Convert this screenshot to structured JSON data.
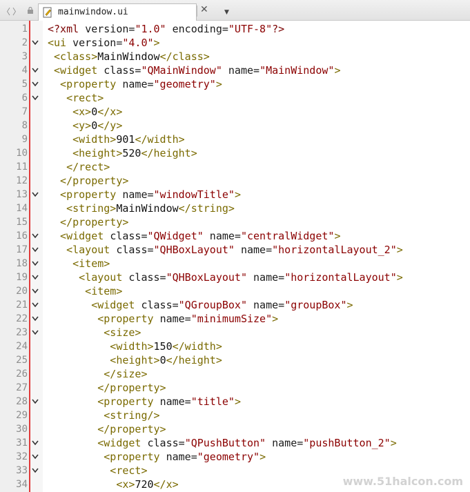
{
  "tab": {
    "title": "mainwindow.ui",
    "icons": [
      "back-arrow-icon",
      "forward-arrow-icon",
      "lock-icon",
      "file-icon",
      "dropdown-icon",
      "close-icon"
    ]
  },
  "colors": {
    "accent_line": "#e03a3a",
    "tag": "#7a6a00",
    "value": "#8b0000"
  },
  "code_lines": [
    {
      "n": "1",
      "fold": false,
      "tokens": [
        [
          "p",
          "<?xml "
        ],
        [
          "attr",
          "version="
        ],
        [
          "val",
          "\"1.0\""
        ],
        [
          "attr",
          " encoding="
        ],
        [
          "val",
          "\"UTF-8\""
        ],
        [
          "p",
          "?>"
        ]
      ]
    },
    {
      "n": "2",
      "fold": true,
      "tokens": [
        [
          "tag",
          "<ui "
        ],
        [
          "attr",
          "version="
        ],
        [
          "val",
          "\"4.0\""
        ],
        [
          "tag",
          ">"
        ]
      ]
    },
    {
      "n": "3",
      "fold": false,
      "tokens": [
        [
          "tag",
          " <class>"
        ],
        [
          "text",
          "MainWindow"
        ],
        [
          "tag",
          "</class>"
        ]
      ]
    },
    {
      "n": "4",
      "fold": true,
      "tokens": [
        [
          "tag",
          " <widget "
        ],
        [
          "attr",
          "class="
        ],
        [
          "val",
          "\"QMainWindow\""
        ],
        [
          "attr",
          " name="
        ],
        [
          "val",
          "\"MainWindow\""
        ],
        [
          "tag",
          ">"
        ]
      ]
    },
    {
      "n": "5",
      "fold": true,
      "tokens": [
        [
          "tag",
          "  <property "
        ],
        [
          "attr",
          "name="
        ],
        [
          "val",
          "\"geometry\""
        ],
        [
          "tag",
          ">"
        ]
      ]
    },
    {
      "n": "6",
      "fold": true,
      "tokens": [
        [
          "tag",
          "   <rect>"
        ]
      ]
    },
    {
      "n": "7",
      "fold": false,
      "tokens": [
        [
          "tag",
          "    <x>"
        ],
        [
          "text",
          "0"
        ],
        [
          "tag",
          "</x>"
        ]
      ]
    },
    {
      "n": "8",
      "fold": false,
      "tokens": [
        [
          "tag",
          "    <y>"
        ],
        [
          "text",
          "0"
        ],
        [
          "tag",
          "</y>"
        ]
      ]
    },
    {
      "n": "9",
      "fold": false,
      "tokens": [
        [
          "tag",
          "    <width>"
        ],
        [
          "text",
          "901"
        ],
        [
          "tag",
          "</width>"
        ]
      ]
    },
    {
      "n": "10",
      "fold": false,
      "tokens": [
        [
          "tag",
          "    <height>"
        ],
        [
          "text",
          "520"
        ],
        [
          "tag",
          "</height>"
        ]
      ]
    },
    {
      "n": "11",
      "fold": false,
      "tokens": [
        [
          "tag",
          "   </rect>"
        ]
      ]
    },
    {
      "n": "12",
      "fold": false,
      "tokens": [
        [
          "tag",
          "  </property>"
        ]
      ]
    },
    {
      "n": "13",
      "fold": true,
      "tokens": [
        [
          "tag",
          "  <property "
        ],
        [
          "attr",
          "name="
        ],
        [
          "val",
          "\"windowTitle\""
        ],
        [
          "tag",
          ">"
        ]
      ]
    },
    {
      "n": "14",
      "fold": false,
      "tokens": [
        [
          "tag",
          "   <string>"
        ],
        [
          "text",
          "MainWindow"
        ],
        [
          "tag",
          "</string>"
        ]
      ]
    },
    {
      "n": "15",
      "fold": false,
      "tokens": [
        [
          "tag",
          "  </property>"
        ]
      ]
    },
    {
      "n": "16",
      "fold": true,
      "tokens": [
        [
          "tag",
          "  <widget "
        ],
        [
          "attr",
          "class="
        ],
        [
          "val",
          "\"QWidget\""
        ],
        [
          "attr",
          " name="
        ],
        [
          "val",
          "\"centralWidget\""
        ],
        [
          "tag",
          ">"
        ]
      ]
    },
    {
      "n": "17",
      "fold": true,
      "tokens": [
        [
          "tag",
          "   <layout "
        ],
        [
          "attr",
          "class="
        ],
        [
          "val",
          "\"QHBoxLayout\""
        ],
        [
          "attr",
          " name="
        ],
        [
          "val",
          "\"horizontalLayout_2\""
        ],
        [
          "tag",
          ">"
        ]
      ]
    },
    {
      "n": "18",
      "fold": true,
      "tokens": [
        [
          "tag",
          "    <item>"
        ]
      ]
    },
    {
      "n": "19",
      "fold": true,
      "tokens": [
        [
          "tag",
          "     <layout "
        ],
        [
          "attr",
          "class="
        ],
        [
          "val",
          "\"QHBoxLayout\""
        ],
        [
          "attr",
          " name="
        ],
        [
          "val",
          "\"horizontalLayout\""
        ],
        [
          "tag",
          ">"
        ]
      ]
    },
    {
      "n": "20",
      "fold": true,
      "tokens": [
        [
          "tag",
          "      <item>"
        ]
      ]
    },
    {
      "n": "21",
      "fold": true,
      "tokens": [
        [
          "tag",
          "       <widget "
        ],
        [
          "attr",
          "class="
        ],
        [
          "val",
          "\"QGroupBox\""
        ],
        [
          "attr",
          " name="
        ],
        [
          "val",
          "\"groupBox\""
        ],
        [
          "tag",
          ">"
        ]
      ]
    },
    {
      "n": "22",
      "fold": true,
      "tokens": [
        [
          "tag",
          "        <property "
        ],
        [
          "attr",
          "name="
        ],
        [
          "val",
          "\"minimumSize\""
        ],
        [
          "tag",
          ">"
        ]
      ]
    },
    {
      "n": "23",
      "fold": true,
      "tokens": [
        [
          "tag",
          "         <size>"
        ]
      ]
    },
    {
      "n": "24",
      "fold": false,
      "tokens": [
        [
          "tag",
          "          <width>"
        ],
        [
          "text",
          "150"
        ],
        [
          "tag",
          "</width>"
        ]
      ]
    },
    {
      "n": "25",
      "fold": false,
      "tokens": [
        [
          "tag",
          "          <height>"
        ],
        [
          "text",
          "0"
        ],
        [
          "tag",
          "</height>"
        ]
      ]
    },
    {
      "n": "26",
      "fold": false,
      "tokens": [
        [
          "tag",
          "         </size>"
        ]
      ]
    },
    {
      "n": "27",
      "fold": false,
      "tokens": [
        [
          "tag",
          "        </property>"
        ]
      ]
    },
    {
      "n": "28",
      "fold": true,
      "tokens": [
        [
          "tag",
          "        <property "
        ],
        [
          "attr",
          "name="
        ],
        [
          "val",
          "\"title\""
        ],
        [
          "tag",
          ">"
        ]
      ]
    },
    {
      "n": "29",
      "fold": false,
      "tokens": [
        [
          "tag",
          "         <string/>"
        ]
      ]
    },
    {
      "n": "30",
      "fold": false,
      "tokens": [
        [
          "tag",
          "        </property>"
        ]
      ]
    },
    {
      "n": "31",
      "fold": true,
      "tokens": [
        [
          "tag",
          "        <widget "
        ],
        [
          "attr",
          "class="
        ],
        [
          "val",
          "\"QPushButton\""
        ],
        [
          "attr",
          " name="
        ],
        [
          "val",
          "\"pushButton_2\""
        ],
        [
          "tag",
          ">"
        ]
      ]
    },
    {
      "n": "32",
      "fold": true,
      "tokens": [
        [
          "tag",
          "         <property "
        ],
        [
          "attr",
          "name="
        ],
        [
          "val",
          "\"geometry\""
        ],
        [
          "tag",
          ">"
        ]
      ]
    },
    {
      "n": "33",
      "fold": true,
      "tokens": [
        [
          "tag",
          "          <rect>"
        ]
      ]
    },
    {
      "n": "34",
      "fold": false,
      "tokens": [
        [
          "tag",
          "           <x>"
        ],
        [
          "text",
          "720"
        ],
        [
          "tag",
          "</x>"
        ]
      ]
    }
  ],
  "watermark": "www.51halcon.com"
}
